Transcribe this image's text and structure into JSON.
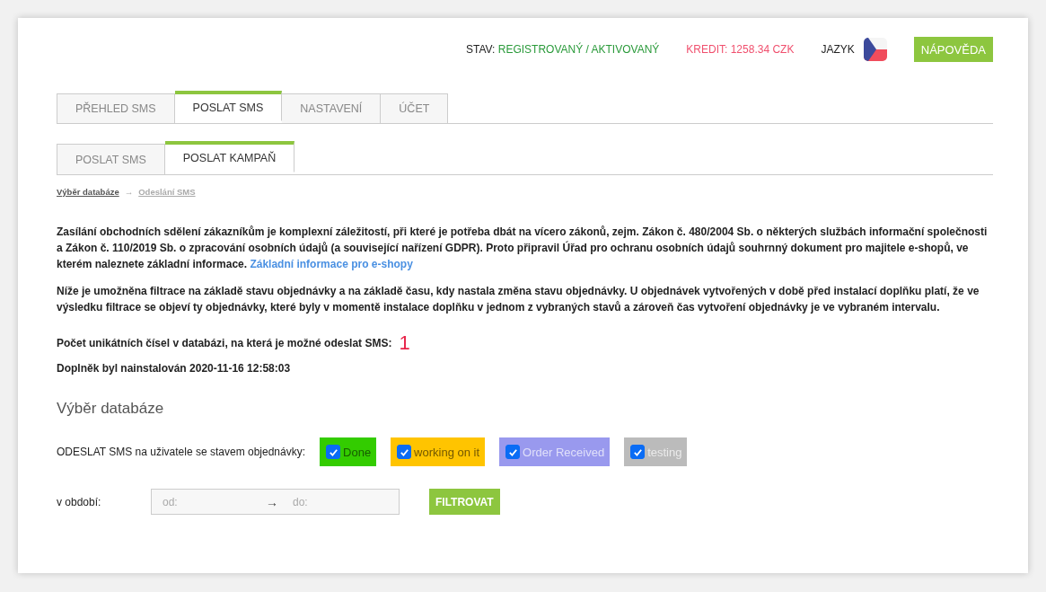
{
  "header": {
    "status_label": "STAV:",
    "status_value": "REGISTROVANÝ / AKTIVOVANÝ",
    "credit": "KREDIT: 1258.34 CZK",
    "language_label": "JAZYK",
    "help_button": "NÁPOVĚDA"
  },
  "tabs": [
    {
      "label": "PŘEHLED SMS",
      "selected": false
    },
    {
      "label": "POSLAT SMS",
      "selected": true
    },
    {
      "label": "NASTAVENÍ",
      "selected": false
    },
    {
      "label": "ÚČET",
      "selected": false
    }
  ],
  "subtabs": [
    {
      "label": "POSLAT SMS",
      "selected": false
    },
    {
      "label": "POSLAT KAMPAŇ",
      "selected": true
    }
  ],
  "breadcrumb": [
    {
      "label": "Výběr databáze",
      "selected": true
    },
    {
      "label": "Odeslání SMS",
      "selected": false
    }
  ],
  "breadcrumb_separator": "→",
  "intro": {
    "text": "Zasílání obchodních sdělení zákazníkům je komplexní záležitostí, při které je potřeba dbát na vícero zákonů, zejm. Zákon č. 480/2004 Sb. o některých službách informační společnosti a Zákon č. 110/2019 Sb. o zpracování osobních údajů (a související nařízení GDPR). Proto připravil Úřad pro ochranu osobních údajů souhrnný dokument pro majitele e-shopů, ve kterém naleznete základní informace.",
    "link": "Základní informace pro e-shopy"
  },
  "filter_note": "Níže je umožněna filtrace na základě stavu objednávky a na základě času, kdy nastala změna stavu objednávky. U objednávek vytvořených v době před instalací doplňku platí, že ve výsledku filtrace se objeví ty objednávky, které byly v momentě instalace doplňku v jednom z vybraných stavů a zároveň čas vytvoření objednávky je ve vybraném intervalu.",
  "unique_count": {
    "label": "Počet unikátních čísel v databázi, na která je možné odeslat SMS:",
    "value": "1"
  },
  "installed": "Doplněk byl nainstalován 2020-11-16 12:58:03",
  "section_title": "Výběr databáze",
  "status_filter": {
    "label": "ODESLAT SMS na uživatele se stavem objednávky:",
    "options": [
      {
        "label": "Done",
        "checked": true,
        "color": "#33cc00"
      },
      {
        "label": "working on it",
        "checked": true,
        "color": "#ffc400"
      },
      {
        "label": "Order Received",
        "checked": true,
        "color": "#9999ee"
      },
      {
        "label": "testing",
        "checked": true,
        "color": "#bbbbbb"
      }
    ]
  },
  "period": {
    "label": "v období:",
    "from_placeholder": "od:",
    "separator": "→",
    "to_placeholder": "do:",
    "button": "FILTROVAT"
  }
}
